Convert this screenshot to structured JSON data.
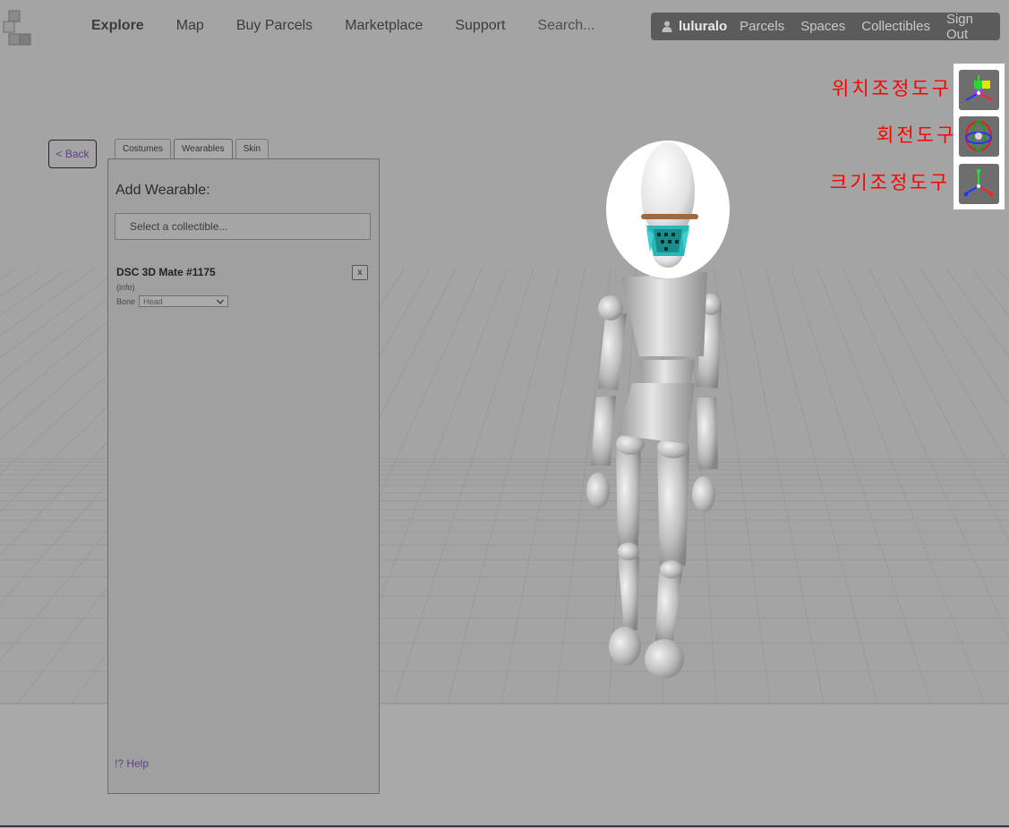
{
  "nav": {
    "items": [
      "Explore",
      "Map",
      "Buy Parcels",
      "Marketplace",
      "Support"
    ],
    "search_placeholder": "Search..."
  },
  "user": {
    "name": "luluralo",
    "links": [
      "Parcels",
      "Spaces",
      "Collectibles",
      "Sign Out"
    ]
  },
  "tools": {
    "position_label": "위치조정도구",
    "rotate_label": "회전도구",
    "scale_label": "크기조정도구"
  },
  "back_label": "< Back",
  "tabs": [
    "Costumes",
    "Wearables",
    "Skin"
  ],
  "panel": {
    "heading": "Add Wearable:",
    "select_placeholder": "Select a collectible...",
    "item_title": "DSC 3D Mate #1175",
    "item_info": "(info)",
    "bone_label": "Bone",
    "bone_value": "Head",
    "remove_label": "x",
    "help_label": "!? Help"
  },
  "colors": {
    "accent_link": "#5f3f84",
    "annotation": "#ff0000",
    "userbar": "#5b5b5b"
  },
  "icons": [
    "user-icon",
    "move-tool-icon",
    "rotate-tool-icon",
    "scale-tool-icon",
    "chevron-down-icon",
    "logo-icon"
  ]
}
